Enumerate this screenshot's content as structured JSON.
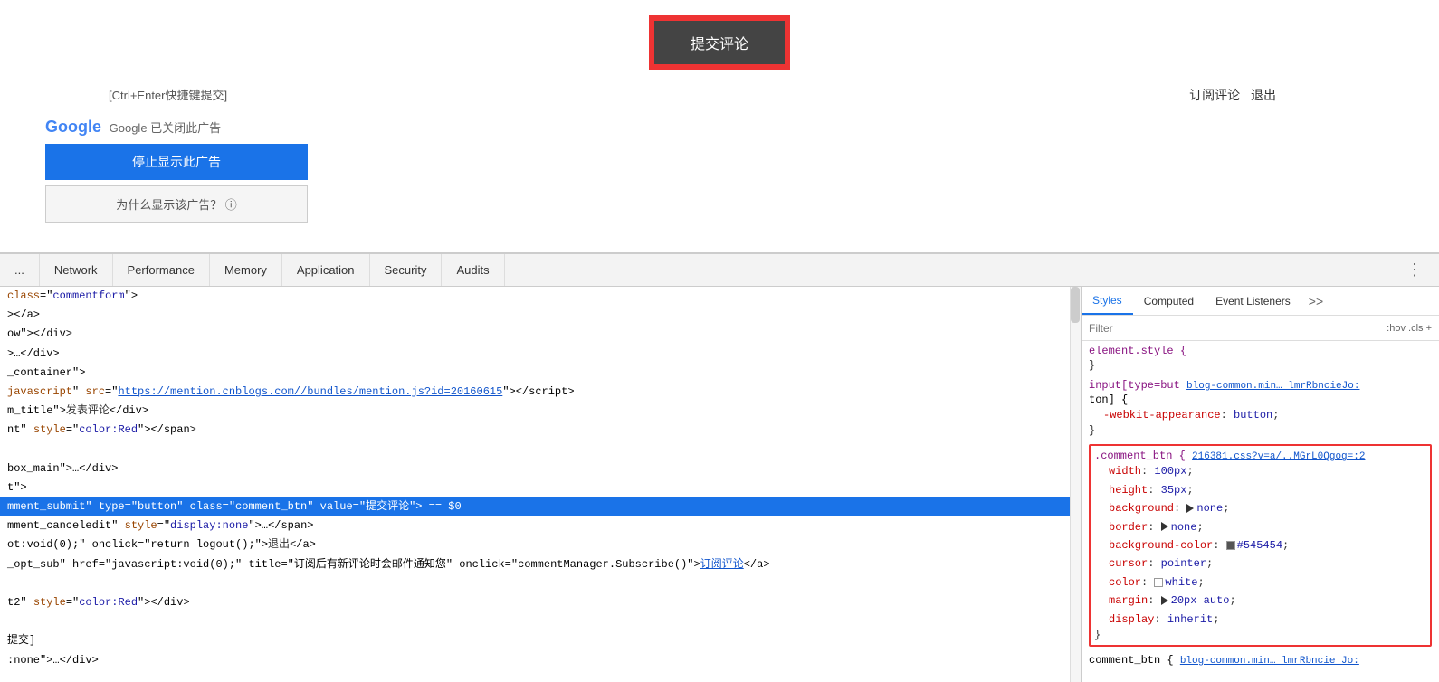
{
  "page": {
    "submit_button_label": "提交评论",
    "shortcut_hint": "[Ctrl+Enter快捷键提交]",
    "subscribe_label": "订阅评论",
    "logout_label": "退出",
    "google_ad": {
      "title": "Google 已关闭此广告",
      "stop_btn": "停止显示此广告",
      "why_btn": "为什么显示该广告？ ⓘ"
    }
  },
  "devtools": {
    "tabs": [
      {
        "label": "...",
        "id": "ellipsis"
      },
      {
        "label": "Network",
        "id": "network"
      },
      {
        "label": "Performance",
        "id": "performance"
      },
      {
        "label": "Memory",
        "id": "memory"
      },
      {
        "label": "Application",
        "id": "application"
      },
      {
        "label": "Security",
        "id": "security"
      },
      {
        "label": "Audits",
        "id": "audits"
      }
    ],
    "html_lines": [
      {
        "id": 1,
        "content": "class=\"commentform\">",
        "selected": false
      },
      {
        "id": 2,
        "content": "></a>",
        "selected": false
      },
      {
        "id": 3,
        "content": "ow\"></div>",
        "selected": false
      },
      {
        "id": 4,
        "content": ">…</div>",
        "selected": false
      },
      {
        "id": 5,
        "content": "_container\">",
        "selected": false
      },
      {
        "id": 6,
        "content": " javascript\" src=\"https://mention.cnblogs.com//bundles/mention.js?id=20160615\"></script>",
        "selected": false,
        "has_link": true
      },
      {
        "id": 7,
        "content": "m_title\">发表评论</div>",
        "selected": false
      },
      {
        "id": 8,
        "content": "nt\" style=\"color:Red\"></span>",
        "selected": false
      },
      {
        "id": 9,
        "content": "",
        "selected": false
      },
      {
        "id": 10,
        "content": "box_main\">…</div>",
        "selected": false
      },
      {
        "id": 11,
        "content": "t\">",
        "selected": false
      },
      {
        "id": 12,
        "content": "mment_submit\" type=\"button\" class=\"comment_btn\" value=\"提交评论\"> == $0",
        "selected": true
      },
      {
        "id": 13,
        "content": "mment_canceledit\" style=\"display:none\">…</span>",
        "selected": false
      },
      {
        "id": 14,
        "content": "ot:void(0);\" onclick=\"return logout();\">退出</a>",
        "selected": false,
        "has_link": true
      },
      {
        "id": 15,
        "content": "_opt_sub\" href=\"javascript:void(0);\" title=\"订阅后有新评论时会邮件通知您\" onclick=\"commentManager.Subscribe()\">订阅评论</a>",
        "selected": false,
        "has_link": true
      },
      {
        "id": 16,
        "content": "",
        "selected": false
      },
      {
        "id": 17,
        "content": "t2\" style=\"color:Red\"></div>",
        "selected": false
      },
      {
        "id": 18,
        "content": "",
        "selected": false
      },
      {
        "id": 19,
        "content": "提交]",
        "selected": false
      },
      {
        "id": 20,
        "content": ":none\">…</div>",
        "selected": false
      }
    ],
    "styles_panel": {
      "tabs": [
        "Styles",
        "Computed",
        "Event Listeners",
        ">>"
      ],
      "filter_placeholder": "Filter",
      "filter_options": ":hov  .cls  +",
      "rules": [
        {
          "selector": "element.style {",
          "props": [],
          "close": "}"
        },
        {
          "selector": "input[type=but",
          "source": "blog-common.min… lmrRbncieJo:",
          "source2": "ton] {",
          "props": [
            {
              "name": "-webkit-appearance",
              "value": "button",
              "strikethrough": false
            }
          ],
          "close": "}"
        },
        {
          "selector": ".comment_btn {",
          "source": "216381.css?v=a/..MGrL0Qgog=:2",
          "highlighted": true,
          "props": [
            {
              "name": "width",
              "value": "100px",
              "strikethrough": false
            },
            {
              "name": "height",
              "value": "35px",
              "strikethrough": false
            },
            {
              "name": "background",
              "value": "none",
              "strikethrough": false,
              "has_triangle": true
            },
            {
              "name": "border",
              "value": "none",
              "strikethrough": false,
              "has_triangle": true
            },
            {
              "name": "background-color",
              "value": "#545454",
              "strikethrough": false,
              "has_swatch": true,
              "swatch_color": "#545454"
            },
            {
              "name": "cursor",
              "value": "pointer",
              "strikethrough": false
            },
            {
              "name": "color",
              "value": "white",
              "strikethrough": false,
              "has_checkbox": true
            },
            {
              "name": "margin",
              "value": "20px auto",
              "strikethrough": false,
              "has_triangle": true
            },
            {
              "name": "display",
              "value": "inherit",
              "strikethrough": false
            }
          ],
          "close": "}"
        }
      ]
    }
  }
}
